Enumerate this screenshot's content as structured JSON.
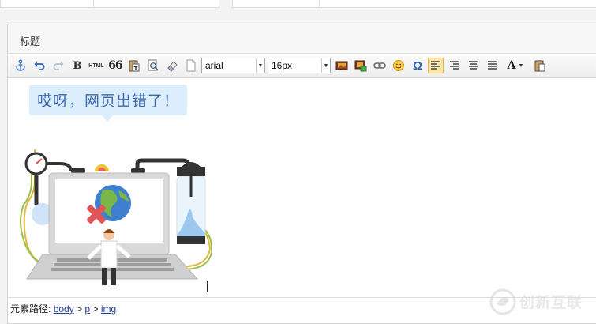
{
  "editor": {
    "title_label": "标题",
    "toolbar": {
      "font_family_value": "arial",
      "font_size_value": "16px",
      "buttons": [
        {
          "name": "anchor-icon"
        },
        {
          "name": "undo-icon"
        },
        {
          "name": "redo-icon"
        },
        {
          "name": "bold-button",
          "text": "B"
        },
        {
          "name": "html-button",
          "text": "HTML"
        },
        {
          "name": "blockquote-button",
          "text": "66"
        },
        {
          "name": "paste-text-icon"
        },
        {
          "name": "find-icon"
        },
        {
          "name": "eraser-icon"
        },
        {
          "name": "new-page-icon"
        },
        {
          "name": "insert-image-icon"
        },
        {
          "name": "insert-multi-image-icon"
        },
        {
          "name": "link-icon"
        },
        {
          "name": "emoticon-icon"
        },
        {
          "name": "special-char-icon",
          "text": "Ω"
        },
        {
          "name": "align-left-icon"
        },
        {
          "name": "align-right-icon"
        },
        {
          "name": "align-center-icon"
        },
        {
          "name": "align-justify-icon"
        },
        {
          "name": "font-color-button",
          "text": "A"
        },
        {
          "name": "paste-icon"
        }
      ]
    },
    "content": {
      "image_caption_text": "哎呀，网页出错了！"
    },
    "statusbar": {
      "path_label": "元素路径:",
      "path": [
        "body",
        "p",
        "img"
      ],
      "separator": ">"
    }
  },
  "watermark": {
    "text": "创新互联"
  },
  "colors": {
    "accent_blue": "#3d6bb4",
    "link_blue": "#1c3b98",
    "active_button": "#fbe6a8"
  }
}
